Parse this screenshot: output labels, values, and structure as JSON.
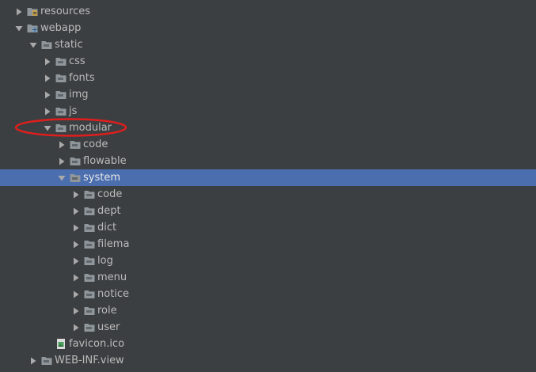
{
  "tree": {
    "rows": [
      {
        "label": "resources",
        "icon": "resources-folder-icon",
        "expanded": false,
        "selected": false
      },
      {
        "label": "webapp",
        "icon": "web-folder-icon",
        "expanded": true,
        "selected": false
      },
      {
        "label": "static",
        "icon": "folder-icon",
        "expanded": true,
        "selected": false
      },
      {
        "label": "css",
        "icon": "folder-icon",
        "expanded": false,
        "selected": false
      },
      {
        "label": "fonts",
        "icon": "folder-icon",
        "expanded": false,
        "selected": false
      },
      {
        "label": "img",
        "icon": "folder-icon",
        "expanded": false,
        "selected": false
      },
      {
        "label": "js",
        "icon": "folder-icon",
        "expanded": false,
        "selected": false
      },
      {
        "label": "modular",
        "icon": "folder-icon",
        "expanded": true,
        "selected": false
      },
      {
        "label": "code",
        "icon": "folder-icon",
        "expanded": false,
        "selected": false
      },
      {
        "label": "flowable",
        "icon": "folder-icon",
        "expanded": false,
        "selected": false
      },
      {
        "label": "system",
        "icon": "folder-icon",
        "expanded": true,
        "selected": true
      },
      {
        "label": "code",
        "icon": "folder-icon",
        "expanded": false,
        "selected": false
      },
      {
        "label": "dept",
        "icon": "folder-icon",
        "expanded": false,
        "selected": false
      },
      {
        "label": "dict",
        "icon": "folder-icon",
        "expanded": false,
        "selected": false
      },
      {
        "label": "filema",
        "icon": "folder-icon",
        "expanded": false,
        "selected": false
      },
      {
        "label": "log",
        "icon": "folder-icon",
        "expanded": false,
        "selected": false
      },
      {
        "label": "menu",
        "icon": "folder-icon",
        "expanded": false,
        "selected": false
      },
      {
        "label": "notice",
        "icon": "folder-icon",
        "expanded": false,
        "selected": false
      },
      {
        "label": "role",
        "icon": "folder-icon",
        "expanded": false,
        "selected": false
      },
      {
        "label": "user",
        "icon": "folder-icon",
        "expanded": false,
        "selected": false
      },
      {
        "label": "favicon.ico",
        "icon": "image-file-icon",
        "leaf": true,
        "selected": false
      },
      {
        "label": "WEB-INF.view",
        "icon": "folder-icon",
        "expanded": false,
        "selected": false
      }
    ]
  },
  "annotation": {
    "shape": "ellipse",
    "color": "#e01e1e",
    "target": "modular"
  },
  "colors": {
    "background": "#3c3f41",
    "selection": "#4b6eaf",
    "text": "#bbbbbb",
    "folder": "#8f979c",
    "arrow": "#a9a9a9"
  }
}
